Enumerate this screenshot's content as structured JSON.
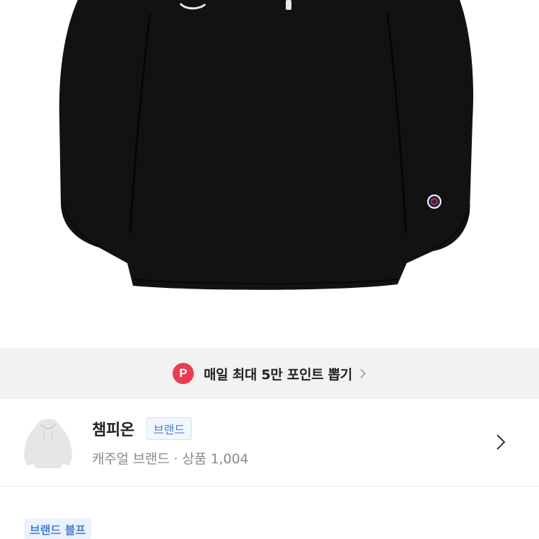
{
  "promo": {
    "badge": "P",
    "text": "매일 최대 5만 포인트 뽑기",
    "accent": "#ec3c53"
  },
  "brand": {
    "logo_icon": "hoodie-logo-icon",
    "name": "챔피온",
    "tag": "브랜드",
    "category": "캐주얼 브랜드",
    "separator": "·",
    "products_label": "상품",
    "products_count": "1,004",
    "chevron_icon": "chevron-right-icon",
    "tag_color": "#4a7fce"
  },
  "brand_pulse": {
    "label": "브랜드 블프"
  },
  "colors": {
    "banner_bg": "#f2f2f3",
    "product": "#111111"
  }
}
